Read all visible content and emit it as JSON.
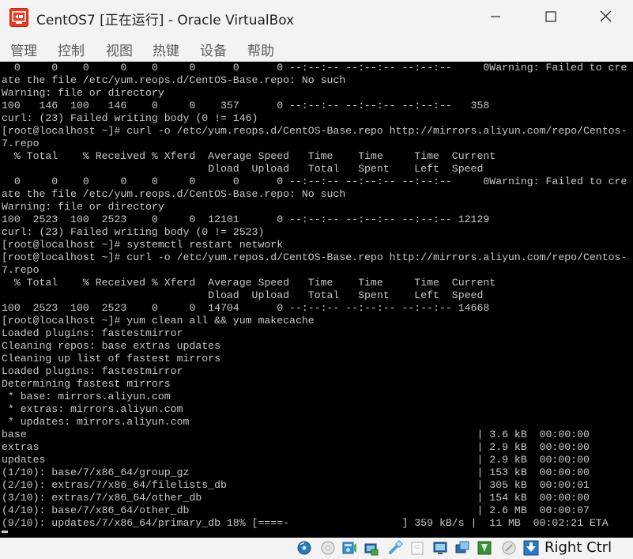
{
  "window": {
    "title": "CentOS7 [正在运行] - Oracle VirtualBox"
  },
  "menu": [
    {
      "label": "管理"
    },
    {
      "label": "控制"
    },
    {
      "label": "视图"
    },
    {
      "label": "热键"
    },
    {
      "label": "设备"
    },
    {
      "label": "帮助"
    }
  ],
  "console": {
    "lines": [
      "  0     0    0     0    0     0      0      0 --:--:-- --:--:-- --:--:--     0Warning: Failed to cre",
      "ate the file /etc/yum.reops.d/CentOS-Base.repo: No such",
      "Warning: file or directory",
      "100   146  100   146    0     0    357      0 --:--:-- --:--:-- --:--:--   358",
      "curl: (23) Failed writing body (0 != 146)",
      "[root@localhost ~]# curl -o /etc/yum.reops.d/CentOS-Base.repo http://mirrors.aliyun.com/repo/Centos-",
      "7.repo",
      "  % Total    % Received % Xferd  Average Speed   Time    Time     Time  Current",
      "                                 Dload  Upload   Total   Spent    Left  Speed",
      "  0     0    0     0    0     0      0      0 --:--:-- --:--:-- --:--:--     0Warning: Failed to cre",
      "ate the file /etc/yum.reops.d/CentOS-Base.repo: No such",
      "Warning: file or directory",
      "100  2523  100  2523    0     0  12101      0 --:--:-- --:--:-- --:--:-- 12129",
      "curl: (23) Failed writing body (0 != 2523)",
      "[root@localhost ~]# systemctl restart network",
      "[root@localhost ~]# curl -o /etc/yum.repos.d/CentOS-Base.repo http://mirrors.aliyun.com/repo/Centos-",
      "7.repo",
      "  % Total    % Received % Xferd  Average Speed   Time    Time     Time  Current",
      "                                 Dload  Upload   Total   Spent    Left  Speed",
      "100  2523  100  2523    0     0  14704      0 --:--:-- --:--:-- --:--:-- 14668",
      "[root@localhost ~]# yum clean all && yum makecache",
      "Loaded plugins: fastestmirror",
      "Cleaning repos: base extras updates",
      "Cleaning up list of fastest mirrors",
      "Loaded plugins: fastestmirror",
      "Determining fastest mirrors",
      " * base: mirrors.aliyun.com",
      " * extras: mirrors.aliyun.com",
      " * updates: mirrors.aliyun.com",
      "base                                                                        | 3.6 kB  00:00:00",
      "extras                                                                      | 2.9 kB  00:00:00",
      "updates                                                                     | 2.9 kB  00:00:00",
      "(1/10): base/7/x86_64/group_gz                                              | 153 kB  00:00:00",
      "(2/10): extras/7/x86_64/filelists_db                                        | 305 kB  00:00:01",
      "(3/10): extras/7/x86_64/other_db                                            | 154 kB  00:00:00",
      "(4/10): base/7/x86_64/other_db                                              | 2.6 MB  00:00:07",
      "(9/10): updates/7/x86_64/primary_db 18% [====-                  ] 359 kB/s |  11 MB  00:02:21 ETA"
    ]
  },
  "statusbar": {
    "icons": [
      "hard-disk-icon",
      "optical-drive-icon",
      "audio-icon",
      "network-icon",
      "usb-icon",
      "shared-folders-icon",
      "display-icon",
      "capture-icon",
      "guest-additions-icon",
      "cpu-icon",
      "mouse-integration-icon",
      "keyboard-icon"
    ],
    "host_key": "Right Ctrl"
  }
}
